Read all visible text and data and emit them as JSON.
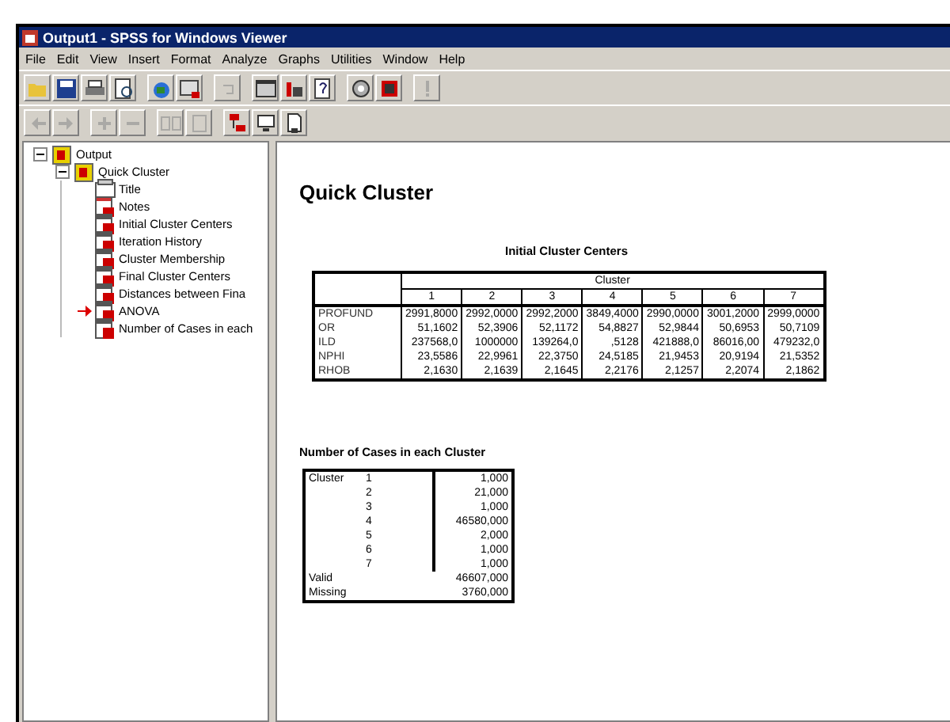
{
  "window": {
    "title": "Output1 - SPSS for Windows Viewer"
  },
  "menu": [
    "File",
    "Edit",
    "View",
    "Insert",
    "Format",
    "Analyze",
    "Graphs",
    "Utilities",
    "Window",
    "Help"
  ],
  "toolbar_1": [
    {
      "kind": "open",
      "disabled": false
    },
    {
      "kind": "save",
      "disabled": false
    },
    {
      "kind": "print",
      "disabled": false
    },
    {
      "kind": "preview",
      "disabled": false
    },
    {
      "kind": "export",
      "disabled": false
    },
    {
      "kind": "dialog",
      "disabled": false
    },
    {
      "kind": "undo",
      "disabled": true
    },
    {
      "kind": "window",
      "disabled": false
    },
    {
      "kind": "chart",
      "disabled": false
    },
    {
      "kind": "help",
      "disabled": false
    },
    {
      "kind": "disc",
      "disabled": false
    },
    {
      "kind": "cases",
      "disabled": false
    },
    {
      "kind": "alert",
      "disabled": true
    }
  ],
  "toolbar_2": [
    {
      "kind": "back",
      "disabled": true
    },
    {
      "kind": "forward",
      "disabled": true
    },
    {
      "kind": "plus",
      "disabled": true
    },
    {
      "kind": "minus",
      "disabled": true
    },
    {
      "kind": "show",
      "disabled": true
    },
    {
      "kind": "hide",
      "disabled": true
    },
    {
      "kind": "tree",
      "disabled": false
    },
    {
      "kind": "monitor",
      "disabled": false
    },
    {
      "kind": "page",
      "disabled": false
    }
  ],
  "outline": [
    {
      "label": "Output",
      "expanded": true,
      "children": [
        {
          "label": "Quick Cluster",
          "expanded": true,
          "children": [
            {
              "label": "Title",
              "kind": "title",
              "current": false
            },
            {
              "label": "Notes",
              "kind": "notes",
              "current": false
            },
            {
              "label": "Initial Cluster Centers",
              "kind": "table",
              "current": false
            },
            {
              "label": "Iteration History",
              "kind": "table",
              "current": false
            },
            {
              "label": "Cluster Membership",
              "kind": "table",
              "current": false
            },
            {
              "label": "Final Cluster Centers",
              "kind": "table",
              "current": false
            },
            {
              "label": "Distances between Fina",
              "kind": "table",
              "current": false
            },
            {
              "label": "ANOVA",
              "kind": "table",
              "current": true
            },
            {
              "label": "Number of Cases in each",
              "kind": "table",
              "current": false
            }
          ]
        }
      ]
    }
  ],
  "content": {
    "heading": "Quick Cluster",
    "centers_table": {
      "title": "Initial Cluster Centers",
      "group_header": "Cluster",
      "columns": [
        "1",
        "2",
        "3",
        "4",
        "5",
        "6",
        "7"
      ],
      "rows": [
        {
          "label": "PROFUND",
          "values": [
            "2991,8000",
            "2992,0000",
            "2992,2000",
            "3849,4000",
            "2990,0000",
            "3001,2000",
            "2999,0000"
          ]
        },
        {
          "label": "OR",
          "values": [
            "51,1602",
            "52,3906",
            "52,1172",
            "54,8827",
            "52,9844",
            "50,6953",
            "50,7109"
          ]
        },
        {
          "label": "ILD",
          "values": [
            "237568,0",
            "1000000",
            "139264,0",
            ",5128",
            "421888,0",
            "86016,00",
            "479232,0"
          ]
        },
        {
          "label": "NPHI",
          "values": [
            "23,5586",
            "22,9961",
            "22,3750",
            "24,5185",
            "21,9453",
            "20,9194",
            "21,5352"
          ]
        },
        {
          "label": "RHOB",
          "values": [
            "2,1630",
            "2,1639",
            "2,1645",
            "2,2176",
            "2,1257",
            "2,2074",
            "2,1862"
          ]
        }
      ]
    },
    "cases_table": {
      "title": "Number of Cases in each Cluster",
      "group_label": "Cluster",
      "rows": [
        {
          "cluster": "1",
          "value": "1,000"
        },
        {
          "cluster": "2",
          "value": "21,000"
        },
        {
          "cluster": "3",
          "value": "1,000"
        },
        {
          "cluster": "4",
          "value": "46580,000"
        },
        {
          "cluster": "5",
          "value": "2,000"
        },
        {
          "cluster": "6",
          "value": "1,000"
        },
        {
          "cluster": "7",
          "value": "1,000"
        }
      ],
      "totals": [
        {
          "label": "Valid",
          "value": "46607,000"
        },
        {
          "label": "Missing",
          "value": "3760,000"
        }
      ]
    }
  }
}
